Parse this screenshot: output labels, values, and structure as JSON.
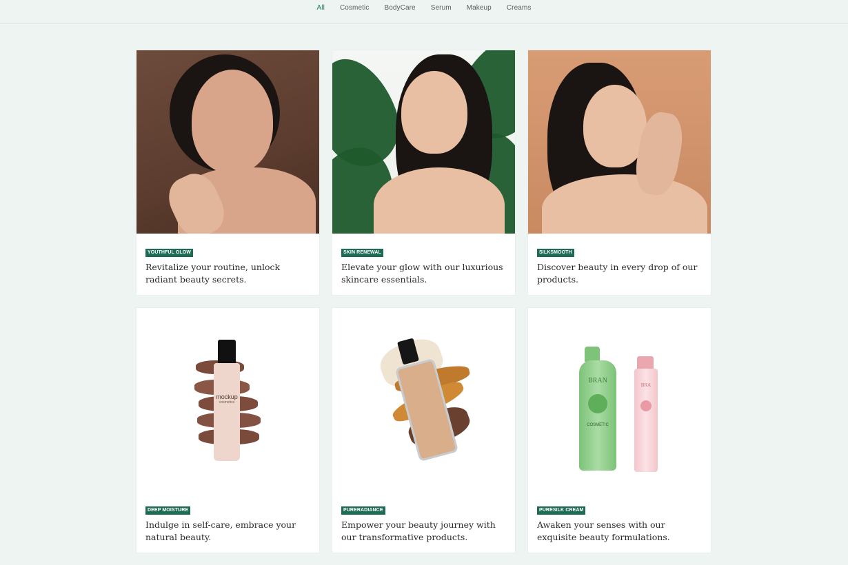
{
  "nav": {
    "tabs": [
      {
        "label": "All",
        "active": true
      },
      {
        "label": "Cosmetic",
        "active": false
      },
      {
        "label": "BodyCare",
        "active": false
      },
      {
        "label": "Serum",
        "active": false
      },
      {
        "label": "Makeup",
        "active": false
      },
      {
        "label": "Creams",
        "active": false
      }
    ]
  },
  "colors": {
    "accent": "#1c6b55",
    "page_bg": "#eef4f1",
    "active_tab": "#1f7a5a"
  },
  "cards": [
    {
      "tag": "YOUTHFUL GLOW",
      "description": "Revitalize your routine, unlock radiant beauty secrets."
    },
    {
      "tag": "SKIN RENEWAL",
      "description": "Elevate your glow with our luxurious skincare essentials."
    },
    {
      "tag": "SILKSMOOTH",
      "description": "Discover beauty in every drop of our products."
    },
    {
      "tag": "DEEP MOISTURE",
      "description": "Indulge in self-care, embrace your natural beauty."
    },
    {
      "tag": "PURERADIANCE",
      "description": "Empower your beauty journey with our transformative products."
    },
    {
      "tag": "PURESILK CREAM",
      "description": "Awaken your senses with our exquisite beauty formulations."
    }
  ],
  "product_labels": {
    "mockup_brand": "mockup",
    "mockup_sub": "cosmetics",
    "brand_a": "BRAN",
    "brand_b": "BRA",
    "cosmetic_label": "COSMETIC"
  }
}
